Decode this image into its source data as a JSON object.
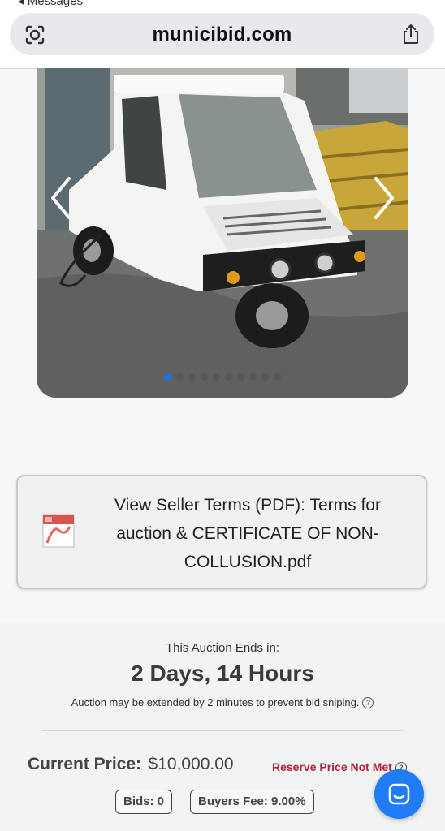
{
  "browser": {
    "back_label": "◂ Messages",
    "url": "municibid.com"
  },
  "carousel": {
    "dot_count": 10,
    "active_index": 0
  },
  "seller_terms": {
    "line1": "View Seller Terms (PDF): Terms for",
    "line2": "auction & CERTIFICATE OF NON-",
    "line3": "COLLUSION.pdf"
  },
  "auction": {
    "ends_label": "This Auction Ends in:",
    "ends_value": "2 Days, 14 Hours",
    "extend_note": "Auction may be extended by 2 minutes to prevent bid sniping.",
    "current_price_label": "Current Price:",
    "current_price_value": "$10,000.00",
    "reserve_status": "Reserve Price Not Met",
    "bids_label": "Bids: 0",
    "buyers_fee_label": "Buyers Fee: 9.00%"
  },
  "colors": {
    "accent": "#1a73e8",
    "reserve": "#b3203a",
    "chat": "#1f7cf5"
  }
}
